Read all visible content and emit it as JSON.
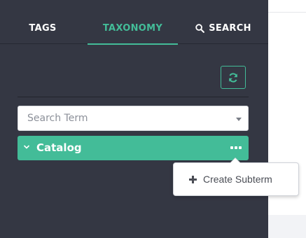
{
  "tabs": [
    {
      "label": "TAGS",
      "active": false
    },
    {
      "label": "TAXONOMY",
      "active": true
    },
    {
      "label": "SEARCH",
      "active": false,
      "icon": "search-icon"
    }
  ],
  "colors": {
    "sidebar_bg": "#343743",
    "accent": "#43bc98",
    "text_light": "#ffffff"
  },
  "toolbar": {
    "refresh_icon": "refresh-icon"
  },
  "search": {
    "placeholder": "Search Term"
  },
  "term": {
    "label": "Catalog",
    "expanded": true,
    "more_icon": "more-icon"
  },
  "context_menu": {
    "items": [
      {
        "label": "Create Subterm",
        "icon": "plus-icon"
      }
    ]
  }
}
